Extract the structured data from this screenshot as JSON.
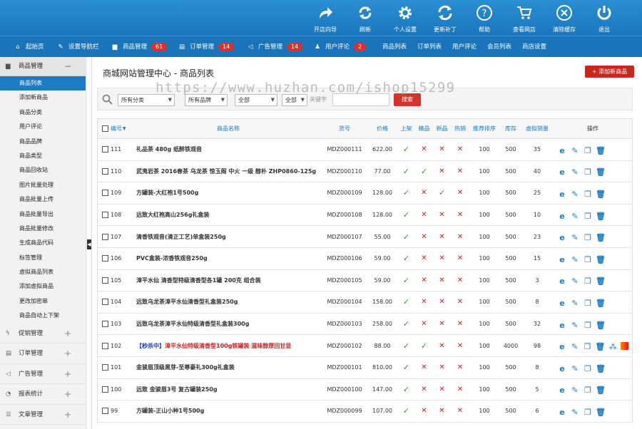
{
  "toolbar": [
    {
      "label": "开店向导",
      "icon": "share-arrow-icon"
    },
    {
      "label": "刷新",
      "icon": "refresh-icon"
    },
    {
      "label": "个人设置",
      "icon": "gear-icon"
    },
    {
      "label": "更新补丁",
      "icon": "update-icon"
    },
    {
      "label": "帮助",
      "icon": "help-icon"
    },
    {
      "label": "查看网店",
      "icon": "cart-icon"
    },
    {
      "label": "清除缓存",
      "icon": "clear-icon"
    },
    {
      "label": "退出",
      "icon": "power-icon"
    }
  ],
  "nav": [
    {
      "label": "起始页",
      "icon": "home-icon",
      "badge": ""
    },
    {
      "label": "设置导航栏",
      "icon": "edit-icon",
      "badge": ""
    },
    {
      "label": "商品管理",
      "icon": "folder-icon",
      "badge": "61"
    },
    {
      "label": "订单管理",
      "icon": "clipboard-icon",
      "badge": "14"
    },
    {
      "label": "广告管理",
      "icon": "megaphone-icon",
      "badge": "14"
    },
    {
      "label": "用户评论",
      "icon": "users-icon",
      "badge": "2"
    },
    {
      "label": "商品列表",
      "icon": "",
      "badge": ""
    },
    {
      "label": "订单列表",
      "icon": "",
      "badge": ""
    },
    {
      "label": "用户评论",
      "icon": "",
      "badge": ""
    },
    {
      "label": "会员列表",
      "icon": "",
      "badge": ""
    },
    {
      "label": "商店设置",
      "icon": "",
      "badge": ""
    }
  ],
  "sidebar": {
    "group": {
      "label": "商品管理",
      "icon": "folder-icon",
      "toggle": "−"
    },
    "items": [
      "商品列表",
      "添加新商品",
      "商品分类",
      "用户评论",
      "商品品牌",
      "商品类型",
      "商品回收站",
      "图片批量处理",
      "商品批量上传",
      "商品批量导出",
      "商品批量修改",
      "生成商品代码",
      "标签管理",
      "虚拟商品列表",
      "添加虚拟商品",
      "更改加密串",
      "商品自动上下架"
    ],
    "active_index": 0,
    "groups": [
      {
        "label": "促销管理",
        "icon": "bolt-icon",
        "toggle": "+"
      },
      {
        "label": "订单管理",
        "icon": "clipboard-icon",
        "toggle": "+"
      },
      {
        "label": "广告管理",
        "icon": "megaphone-icon",
        "toggle": "+"
      },
      {
        "label": "报表统计",
        "icon": "pie-icon",
        "toggle": "+"
      },
      {
        "label": "文章管理",
        "icon": "list-icon",
        "toggle": "+"
      }
    ]
  },
  "page": {
    "title": "商城网站管理中心 - 商品列表",
    "add_button": "+ 添加新商品",
    "watermark": "https://www.huzhan.com/ishop15299"
  },
  "filter": {
    "category": "所有分类",
    "brand": "所有品牌",
    "status1": "全部",
    "status2": "全部",
    "keyword_label": "关键字",
    "keyword_value": "",
    "search_button": "搜索"
  },
  "table": {
    "headers": {
      "id": "编号",
      "name": "商品名称",
      "sn": "货号",
      "price": "价格",
      "onsale": "上架",
      "best": "精品",
      "new": "新品",
      "hot": "热销",
      "sort": "推荐排序",
      "stock": "库存",
      "sales": "虚拟销量",
      "ops": "操作"
    },
    "rows": [
      {
        "id": "111",
        "name": "礼品茶 480g 纸醉铁观音",
        "sn": "MDZ000111",
        "price": "622.00",
        "onsale": true,
        "best": false,
        "new": false,
        "hot": false,
        "sort": "100",
        "stock": "500",
        "sales": "35"
      },
      {
        "id": "110",
        "name": "武夷岩茶 2016春茶 乌龙茶 惊玉阁 中火 一级 醇朴 ZHP0860-125g",
        "sn": "MDZ000110",
        "price": "77.00",
        "onsale": true,
        "best": true,
        "new": false,
        "hot": false,
        "sort": "100",
        "stock": "500",
        "sales": "40"
      },
      {
        "id": "109",
        "name": "方罐装-大红袍1号500g",
        "sn": "MDZ000109",
        "price": "128.00",
        "onsale": true,
        "best": false,
        "new": true,
        "hot": false,
        "sort": "100",
        "stock": "500",
        "sales": "25"
      },
      {
        "id": "108",
        "name": "远致大红袍高山256g礼盒装",
        "sn": "MDZ000108",
        "price": "128.00",
        "onsale": true,
        "best": false,
        "new": false,
        "hot": false,
        "sort": "100",
        "stock": "500",
        "sales": "10"
      },
      {
        "id": "107",
        "name": "清香铁观音(清正工艺)单盒装250g",
        "sn": "MDZ000107",
        "price": "55.00",
        "onsale": true,
        "best": false,
        "new": false,
        "hot": false,
        "sort": "100",
        "stock": "500",
        "sales": "23"
      },
      {
        "id": "106",
        "name": "PVC盒装-浓香铁观音250g",
        "sn": "MDZ000106",
        "price": "59.00",
        "onsale": true,
        "best": false,
        "new": false,
        "hot": false,
        "sort": "100",
        "stock": "500",
        "sales": "15"
      },
      {
        "id": "105",
        "name": "漳平水仙 清香型特级清香型各1罐 200克 组合装",
        "sn": "MDZ000105",
        "price": "59.00",
        "onsale": true,
        "best": false,
        "new": false,
        "hot": false,
        "sort": "100",
        "stock": "500",
        "sales": "3"
      },
      {
        "id": "104",
        "name": "远致乌龙茶漳平水仙清香型礼盒装250g",
        "sn": "MDZ000104",
        "price": "158.00",
        "onsale": true,
        "best": false,
        "new": false,
        "hot": false,
        "sort": "100",
        "stock": "500",
        "sales": "8"
      },
      {
        "id": "103",
        "name": "远致乌龙茶漳平水仙特级清香型礼盒装300g",
        "sn": "MDZ000103",
        "price": "258.00",
        "onsale": true,
        "best": false,
        "new": false,
        "hot": false,
        "sort": "100",
        "stock": "500",
        "sales": "32"
      },
      {
        "id": "102",
        "name_prefix": "【秒杀中】",
        "name": "漳平水仙特级清香型100g铁罐装 滋味醇厚回甘显",
        "sn": "MDZ000102",
        "price": "88.00",
        "onsale": true,
        "best": true,
        "new": false,
        "hot": false,
        "sort": "100",
        "stock": "4000",
        "sales": "98",
        "special": true
      },
      {
        "id": "101",
        "name": "金骏眉顶级黑芽-至尊豪礼300g礼盒装",
        "sn": "MDZ000101",
        "price": "810.00",
        "onsale": true,
        "best": false,
        "new": false,
        "hot": false,
        "sort": "100",
        "stock": "500",
        "sales": "8"
      },
      {
        "id": "100",
        "name": "远致 金骏眉3号 复古罐装250g",
        "sn": "MDZ000100",
        "price": "147.00",
        "onsale": true,
        "best": false,
        "new": false,
        "hot": false,
        "sort": "100",
        "stock": "500",
        "sales": "5"
      },
      {
        "id": "99",
        "name": "方罐装-正山小种1号500g",
        "sn": "MDZ000099",
        "price": "107.00",
        "onsale": true,
        "best": false,
        "new": false,
        "hot": false,
        "sort": "100",
        "stock": "500",
        "sales": "6"
      }
    ]
  },
  "colors": {
    "brand": "#1b7cc4",
    "topbar": "#2a8fd1",
    "danger": "#d42020",
    "ok": "#2a9a2a",
    "badge": "#e02f2f"
  }
}
